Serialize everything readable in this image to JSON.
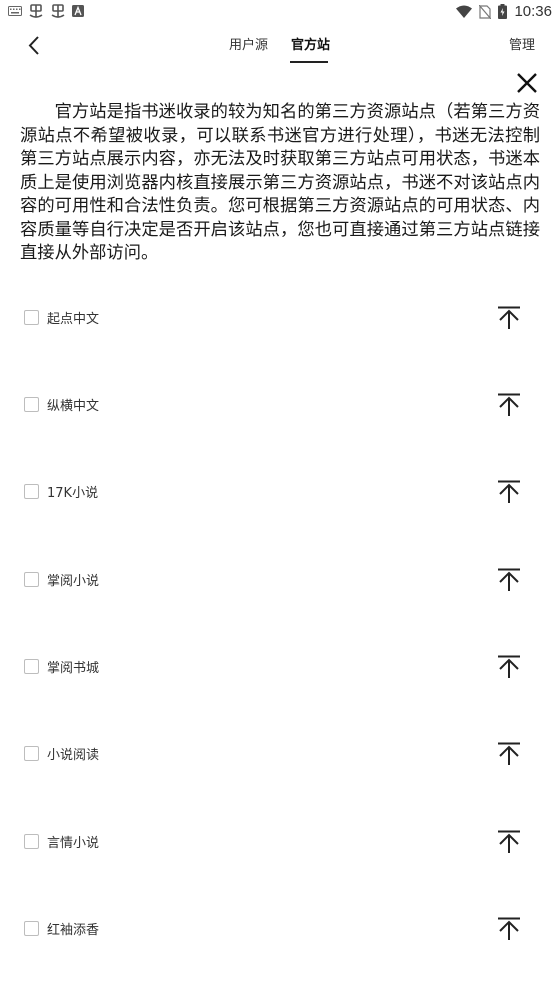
{
  "status_bar": {
    "time": "10:36",
    "left_icons": [
      "keyboard-icon",
      "bug-icon",
      "bug-icon",
      "a-icon"
    ],
    "right_icons": [
      "wifi-icon",
      "no-sim-icon",
      "battery-icon"
    ]
  },
  "header": {
    "tabs": [
      {
        "label": "用户源",
        "active": false
      },
      {
        "label": "官方站",
        "active": true
      }
    ],
    "manage_label": "管理"
  },
  "notice": {
    "text": "官方站是指书迷收录的较为知名的第三方资源站点（若第三方资源站点不希望被收录，可以联系书迷官方进行处理），书迷无法控制第三方站点展示内容，亦无法及时获取第三方站点可用状态，书迷本质上是使用浏览器内核直接展示第三方资源站点，书迷不对该站点内容的可用性和合法性负责。您可根据第三方资源站点的可用状态、内容质量等自行决定是否开启该站点，您也可直接通过第三方站点链接直接从外部访问。"
  },
  "sites": [
    {
      "name": "起点中文",
      "checked": false
    },
    {
      "name": "纵横中文",
      "checked": false
    },
    {
      "name": "17K小说",
      "checked": false
    },
    {
      "name": "掌阅小说",
      "checked": false
    },
    {
      "name": "掌阅书城",
      "checked": false
    },
    {
      "name": "小说阅读",
      "checked": false
    },
    {
      "name": "言情小说",
      "checked": false
    },
    {
      "name": "红袖添香",
      "checked": false
    }
  ],
  "colors": {
    "text": "#222222",
    "checkbox_border": "#bdbdbd",
    "background": "#ffffff"
  }
}
